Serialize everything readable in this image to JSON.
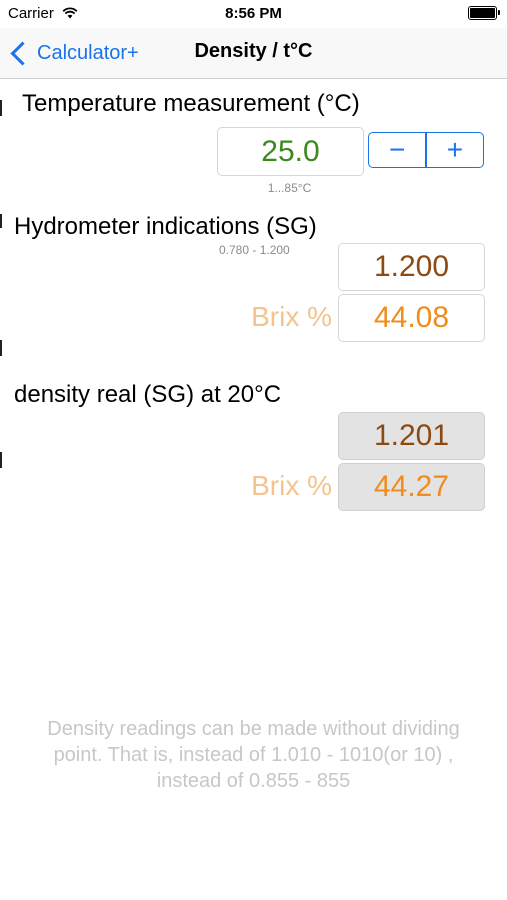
{
  "status_bar": {
    "carrier": "Carrier",
    "time": "8:56 PM"
  },
  "nav": {
    "back_label": "Calculator+",
    "title": "Density / t°C"
  },
  "temperature": {
    "heading": "Temperature measurement (°C)",
    "value": "25.0",
    "range_hint": "1...85°C",
    "minus_label": "−",
    "plus_label": "+"
  },
  "hydrometer": {
    "heading": "Hydrometer indications (SG)",
    "range_hint": "0.780 - 1.200",
    "sg_value": "1.200",
    "brix_label": "Brix %",
    "brix_value": "44.08"
  },
  "result": {
    "heading": "density real (SG) at 20°C",
    "sg_value": "1.201",
    "brix_label": "Brix %",
    "brix_value": "44.27"
  },
  "note": {
    "line1": "Density readings can be made without dividing",
    "line2": "point. That is, instead of 1.010 - 1010(or 10) ,",
    "line3": "instead of 0.855 -  855"
  },
  "colors": {
    "accent": "#1a73ea",
    "temperature_text": "#3a8a1e",
    "sg_text": "#8b4a12",
    "brix_text": "#f08c1e",
    "brix_label": "#f5c38e"
  }
}
